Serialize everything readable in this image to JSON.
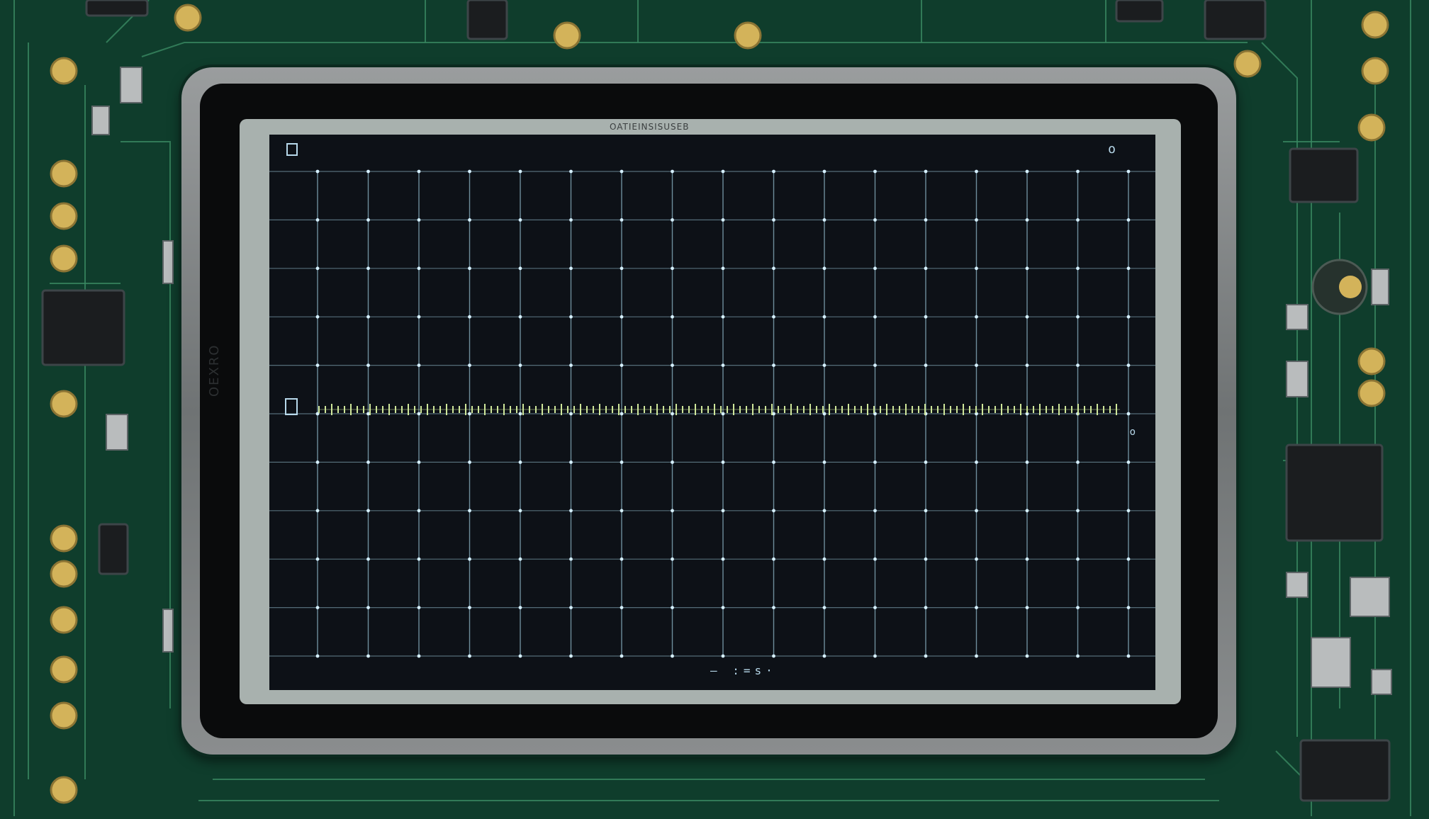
{
  "device": {
    "model_label": "OATIEINSISUSEB",
    "side_label": "OEXRO"
  },
  "screen": {
    "top_left_glyph": "□",
    "top_right_glyph": "o",
    "bottom_readout": "—  :=s·",
    "grid_color": "#8fb7c8",
    "dot_color": "#d6f0ff",
    "trace_color": "#cfe79a"
  },
  "colors": {
    "pcb": "#0f3d2c",
    "trace": "#3a8a63",
    "gold": "#d3b35a",
    "chip": "#1b1d1f"
  }
}
